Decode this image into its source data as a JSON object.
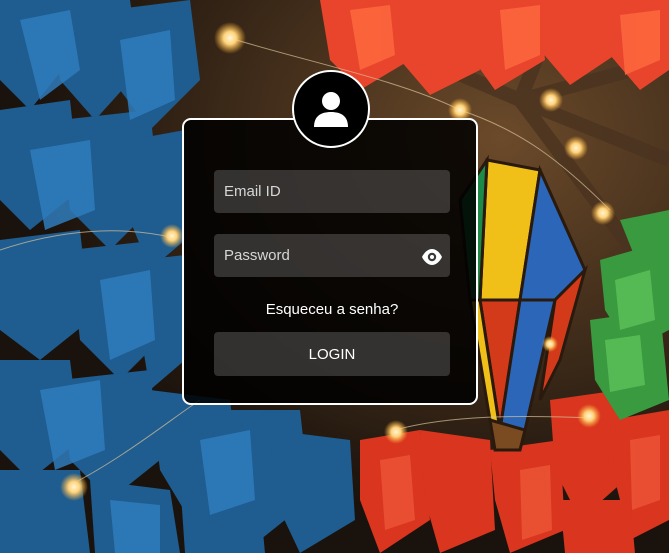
{
  "login_form": {
    "email_placeholder": "Email ID",
    "password_placeholder": "Password",
    "forgot_link": "Esqueceu a senha?",
    "login_label": "LOGIN"
  },
  "icons": {
    "avatar": "user-icon",
    "password_toggle": "eye-icon"
  },
  "colors": {
    "card_background": "#000000",
    "card_border": "#ffffff",
    "field_background": "#3a3a3a",
    "text": "#ffffff"
  }
}
